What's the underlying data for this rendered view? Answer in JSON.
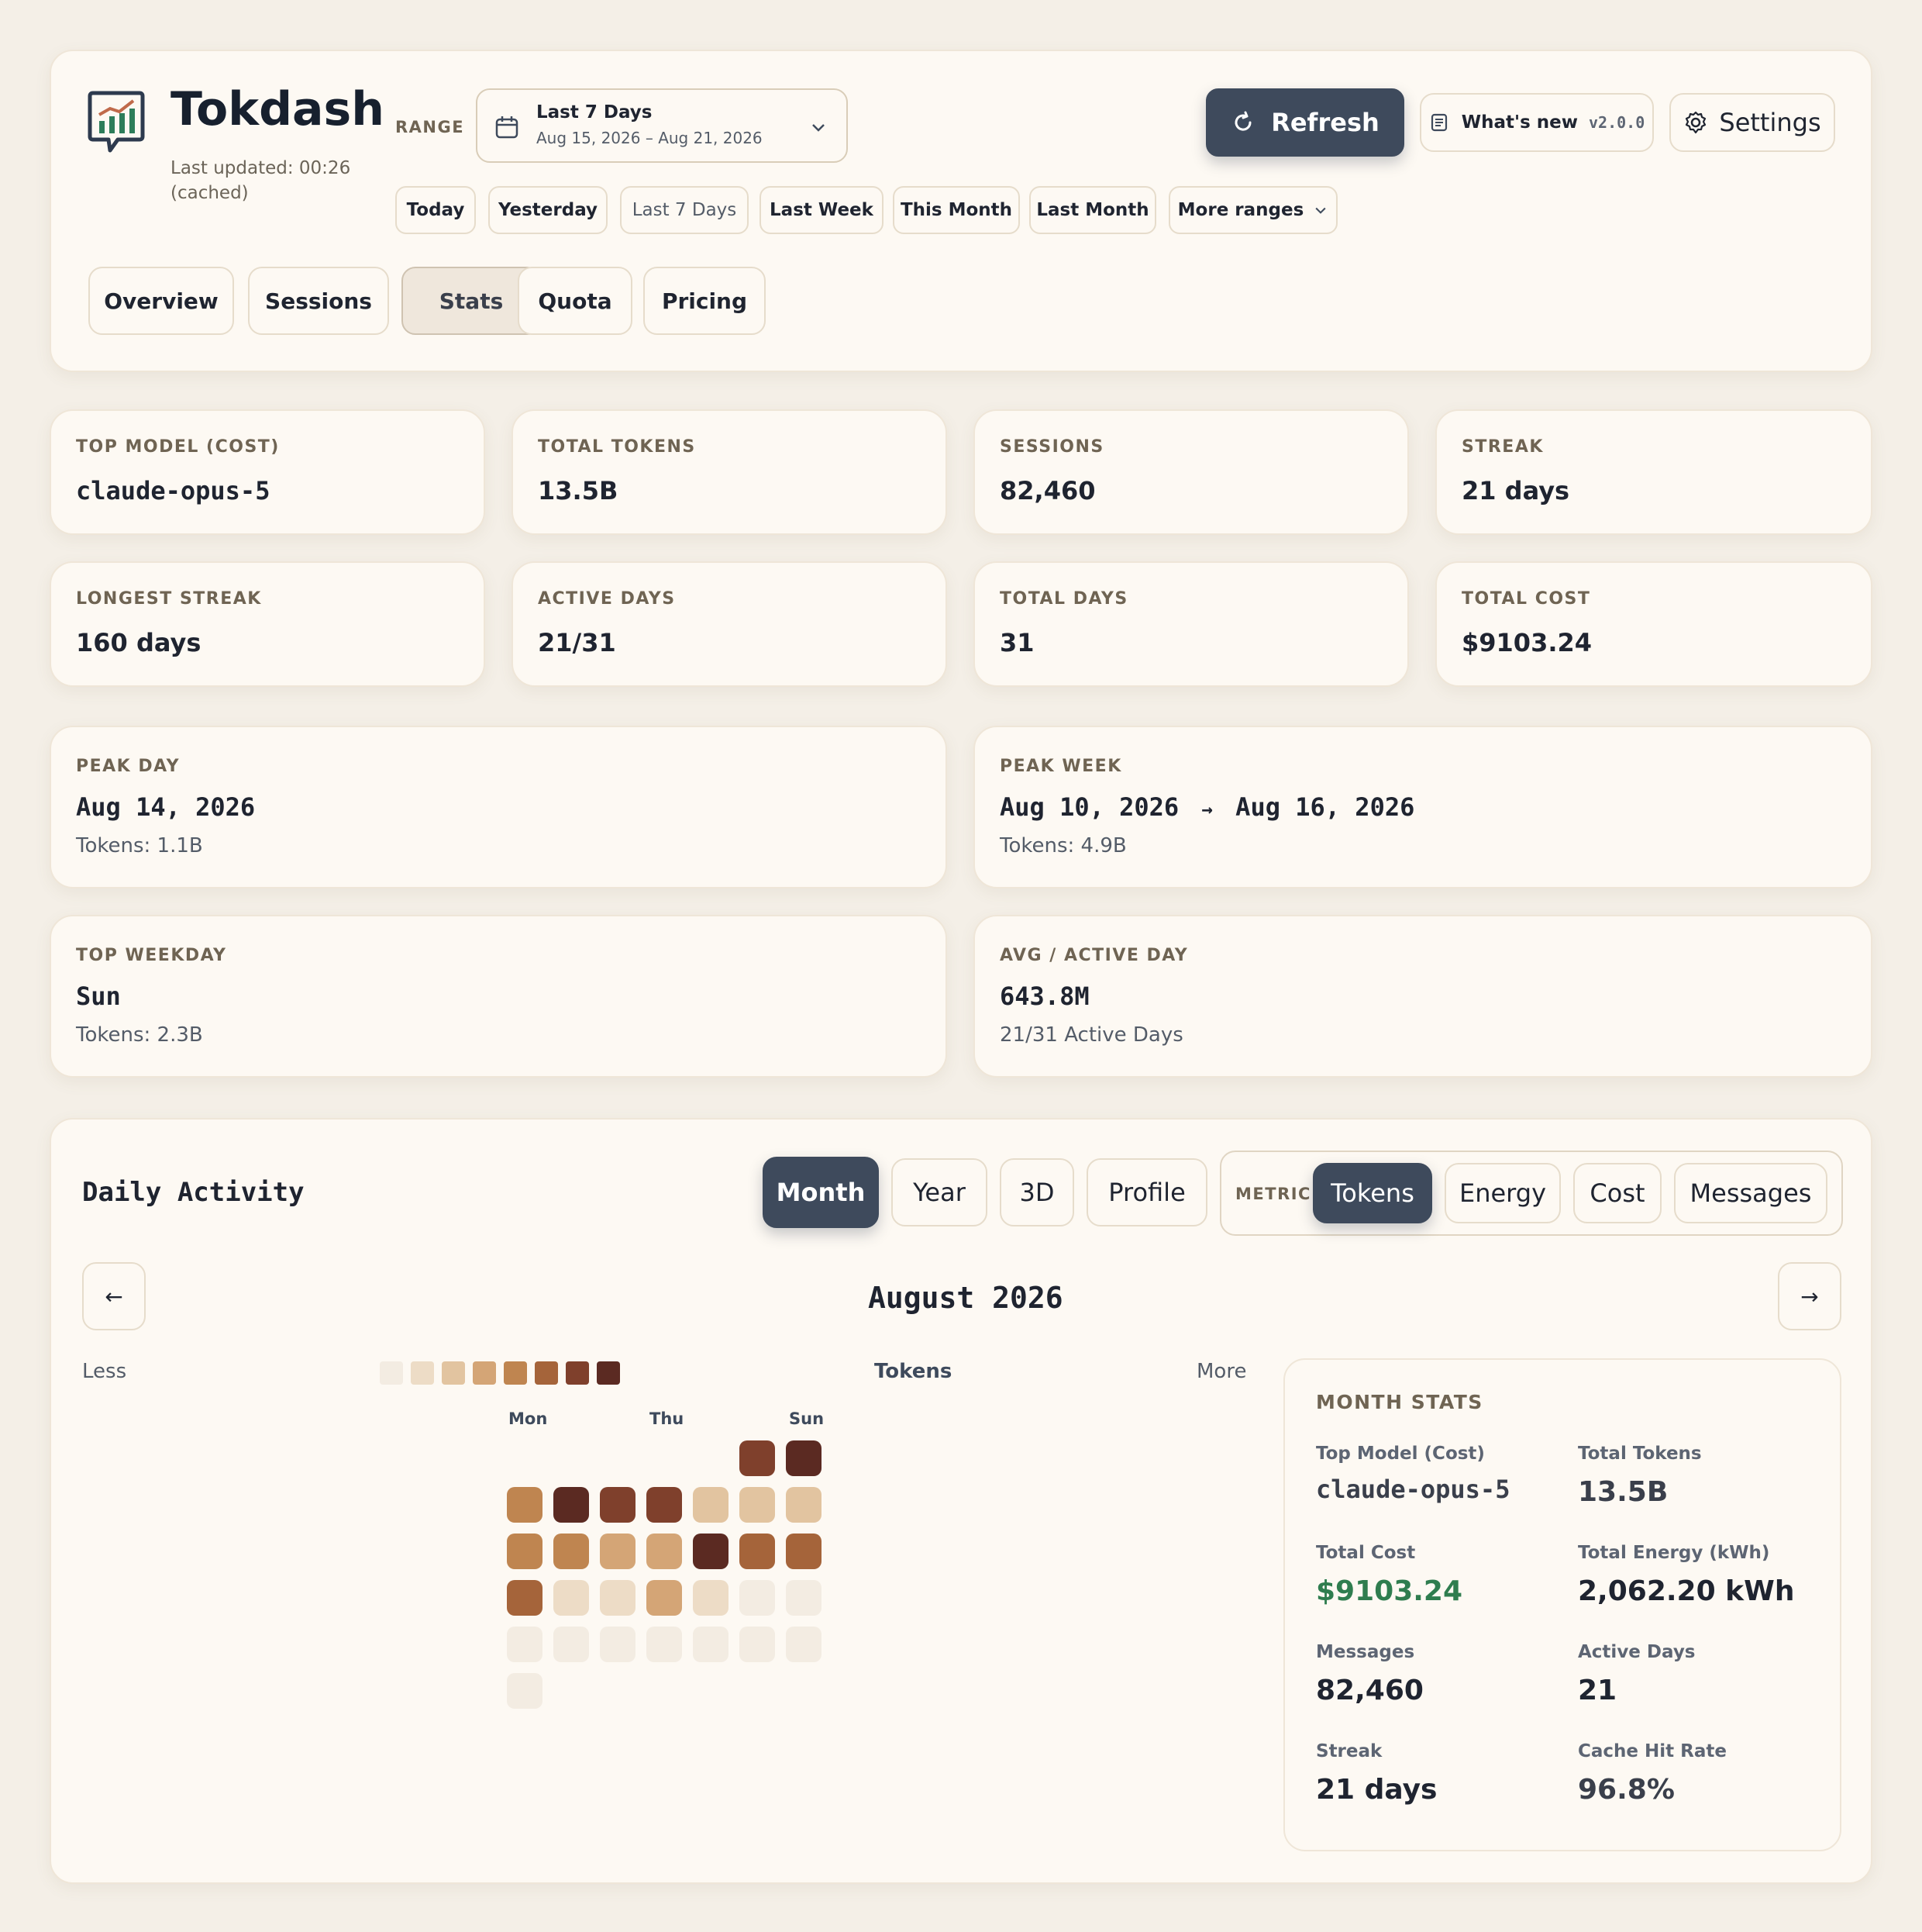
{
  "app": {
    "title": "Tokdash",
    "last_updated": "Last updated: 00:26",
    "cached": "(cached)",
    "logo_icon": "chart-bubble-icon"
  },
  "range": {
    "label": "RANGE",
    "selected_title": "Last 7 Days",
    "selected_dates": "Aug 15, 2026 – Aug 21, 2026",
    "quick": [
      "Today",
      "Yesterday",
      "Last 7 Days",
      "Last Week",
      "This Month",
      "Last Month",
      "More ranges"
    ]
  },
  "header_actions": {
    "refresh": "Refresh",
    "whats_new": "What's new",
    "version": "v2.0.0",
    "settings": "Settings"
  },
  "tabs": [
    "Overview",
    "Sessions",
    "Stats",
    "Quota",
    "Pricing"
  ],
  "active_tab": "Stats",
  "stats": {
    "top_model": {
      "label": "TOP MODEL (COST)",
      "value": "claude-opus-5"
    },
    "total_tokens": {
      "label": "TOTAL TOKENS",
      "value": "13.5B"
    },
    "sessions": {
      "label": "SESSIONS",
      "value": "82,460"
    },
    "streak": {
      "label": "STREAK",
      "value": "21 days"
    },
    "longest_streak": {
      "label": "LONGEST STREAK",
      "value": "160 days"
    },
    "active_days": {
      "label": "ACTIVE DAYS",
      "value": "21/31"
    },
    "total_days": {
      "label": "TOTAL DAYS",
      "value": "31"
    },
    "total_cost": {
      "label": "TOTAL COST",
      "value": "$9103.24"
    }
  },
  "highlights": {
    "peak_day": {
      "label": "PEAK DAY",
      "value": "Aug 14, 2026",
      "sub": "Tokens: 1.1B"
    },
    "peak_week": {
      "label": "PEAK WEEK",
      "start": "Aug 10, 2026",
      "arrow": "→",
      "end": "Aug 16, 2026",
      "sub": "Tokens: 4.9B"
    },
    "top_weekday": {
      "label": "TOP WEEKDAY",
      "value": "Sun",
      "sub": "Tokens: 2.3B"
    },
    "avg_active_day": {
      "label": "AVG / ACTIVE DAY",
      "value": "643.8M",
      "sub": "21/31 Active Days"
    }
  },
  "activity": {
    "title": "Daily Activity",
    "views": [
      "Month",
      "Year",
      "3D",
      "Profile"
    ],
    "active_view": "Month",
    "metric_label": "METRIC",
    "metrics": [
      "Tokens",
      "Energy",
      "Cost",
      "Messages"
    ],
    "active_metric": "Tokens",
    "prev": "←",
    "next": "→",
    "month_title": "August 2026",
    "legend_less": "Less",
    "legend_metric": "Tokens",
    "legend_more": "More",
    "legend_colors": [
      "#f3ece2",
      "#eddcc6",
      "#e2c4a0",
      "#d4a576",
      "#bf8550",
      "#a5643a",
      "#7f402c",
      "#5b2a22"
    ],
    "day_headers": [
      "Mon",
      "Thu",
      "Sun"
    ],
    "heatmap_levels": [
      [
        null,
        null,
        null,
        null,
        null,
        6,
        7
      ],
      [
        4,
        7,
        6,
        6,
        2,
        2,
        2
      ],
      [
        4,
        4,
        3,
        3,
        7,
        5,
        5
      ],
      [
        5,
        1,
        1,
        3,
        1,
        0,
        0
      ],
      [
        0,
        0,
        0,
        0,
        0,
        0,
        0
      ],
      [
        0,
        null,
        null,
        null,
        null,
        null,
        null
      ]
    ]
  },
  "month_stats": {
    "title": "MONTH STATS",
    "top_model_label": "Top Model (Cost)",
    "top_model": "claude-opus-5",
    "total_tokens_label": "Total Tokens",
    "total_tokens": "13.5B",
    "total_cost_label": "Total Cost",
    "total_cost": "$9103.24",
    "total_energy_label": "Total Energy (kWh)",
    "total_energy": "2,062.20 kWh",
    "messages_label": "Messages",
    "messages": "82,460",
    "active_days_label": "Active Days",
    "active_days": "21",
    "streak_label": "Streak",
    "streak": "21 days",
    "cache_hit_label": "Cache Hit Rate",
    "cache_hit": "96.8%",
    "cost_color": "#2f7d4f"
  }
}
